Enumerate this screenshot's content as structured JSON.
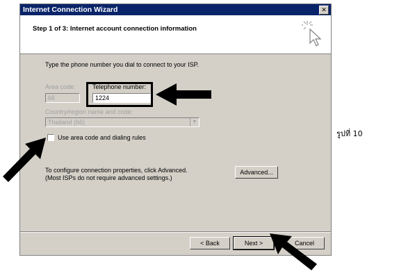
{
  "window": {
    "title": "Internet Connection Wizard",
    "close_label": "✕"
  },
  "header": {
    "step_title": "Step 1 of 3: Internet account connection information"
  },
  "form": {
    "instruction": "Type the phone number you dial to connect to your ISP.",
    "area_code_label": "Area code:",
    "area_code_value": "66",
    "telephone_label": "Telephone number:",
    "telephone_value": "1224",
    "country_label": "Country/region name and code:",
    "country_value": "Thailand (66)",
    "use_area_code_label": "Use area code and dialing rules",
    "use_area_code_checked": false,
    "advanced_text_1": "To configure connection properties, click Advanced.",
    "advanced_text_2": "(Most ISPs do not require advanced settings.)",
    "advanced_button": "Advanced..."
  },
  "footer": {
    "back_button": "< Back",
    "next_button": "Next >",
    "cancel_button": "Cancel"
  },
  "caption": "รูปที่ 10",
  "colors": {
    "titlebar": "#0a246a",
    "dialog_bg": "#d4d0c8",
    "annotation": "#000000"
  }
}
